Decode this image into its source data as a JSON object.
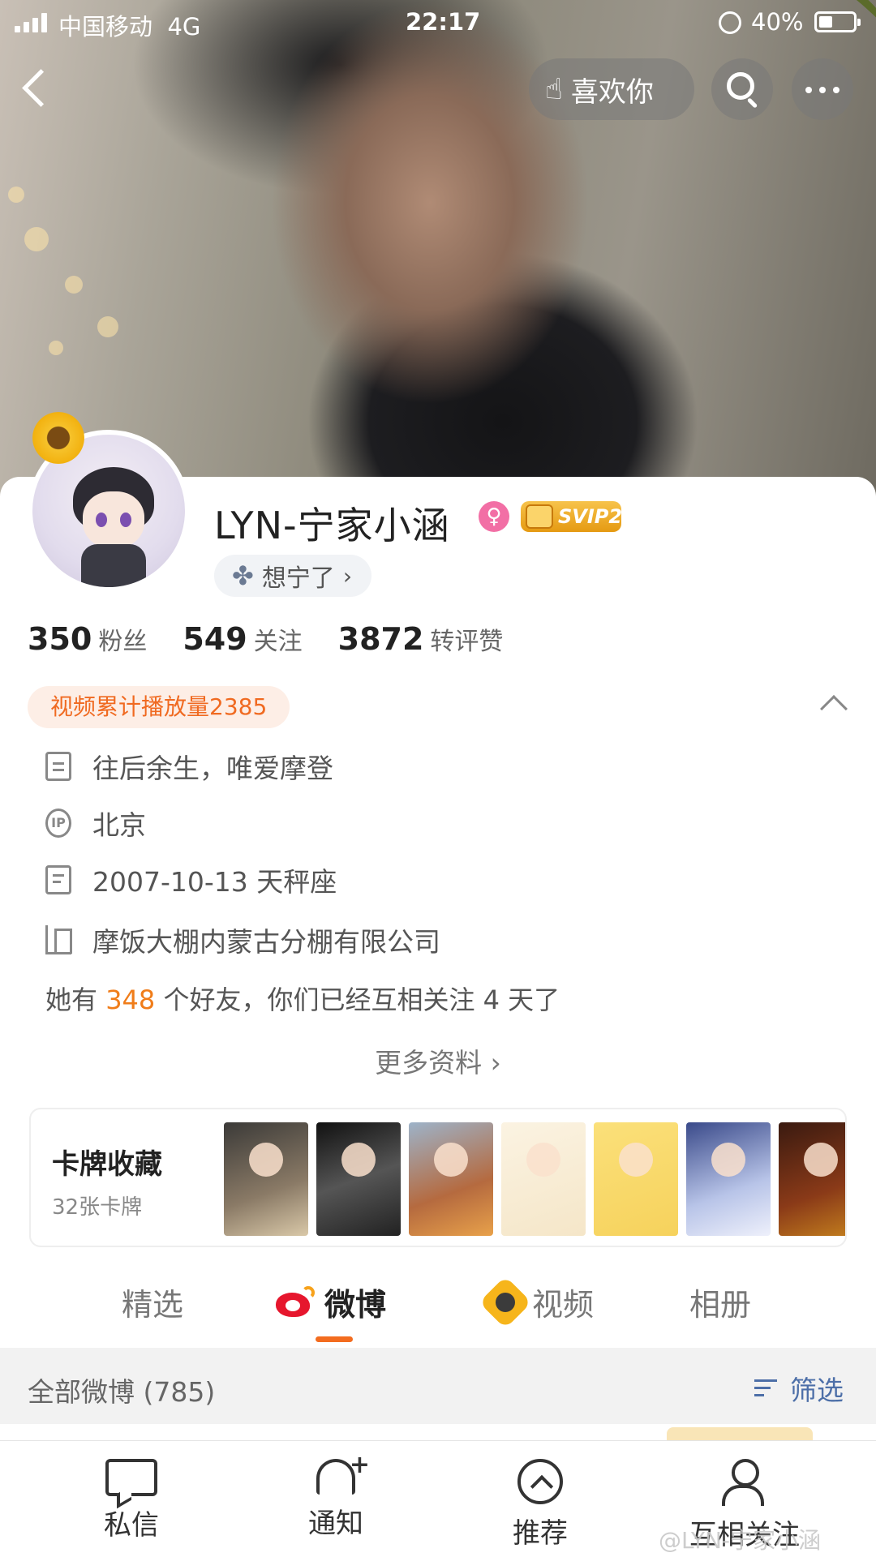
{
  "status_bar": {
    "carrier": "中国移动",
    "network": "4G",
    "time": "22:17",
    "battery": "40%"
  },
  "header": {
    "like_label": "喜欢你"
  },
  "profile": {
    "name": "LYN-宁家小涵",
    "gender_symbol": "♀",
    "vip_label": "SVIP2",
    "mood": "想宁了",
    "stats": [
      {
        "value": "350",
        "label": "粉丝"
      },
      {
        "value": "549",
        "label": "关注"
      },
      {
        "value": "3872",
        "label": "转评赞"
      }
    ],
    "video_plays": "视频累计播放量2385",
    "info": {
      "bio": "往后余生，唯爱摩登",
      "ip_location": "北京",
      "birthday": "2007-10-13 天秤座",
      "company": "摩饭大棚内蒙古分棚有限公司"
    },
    "friends": {
      "prefix": "她有",
      "count": "348",
      "suffix": "个好友，你们已经互相关注 4 天了"
    },
    "more_info": "更多资料"
  },
  "card_collection": {
    "title": "卡牌收藏",
    "count": "32张卡牌"
  },
  "tabs": [
    {
      "label": "精选"
    },
    {
      "label": "微博"
    },
    {
      "label": "视频"
    },
    {
      "label": "相册"
    }
  ],
  "filter": {
    "all_label": "全部微博 (785)",
    "filter_label": "筛选"
  },
  "bottom_bar": [
    {
      "label": "私信"
    },
    {
      "label": "通知"
    },
    {
      "label": "推荐"
    },
    {
      "label": "互相关注"
    }
  ],
  "watermark": "@LYN-宁家小涵",
  "colors": {
    "accent_orange": "#f36c1f",
    "link_blue": "#4d6fa8",
    "highlight": "#f07d1a"
  }
}
